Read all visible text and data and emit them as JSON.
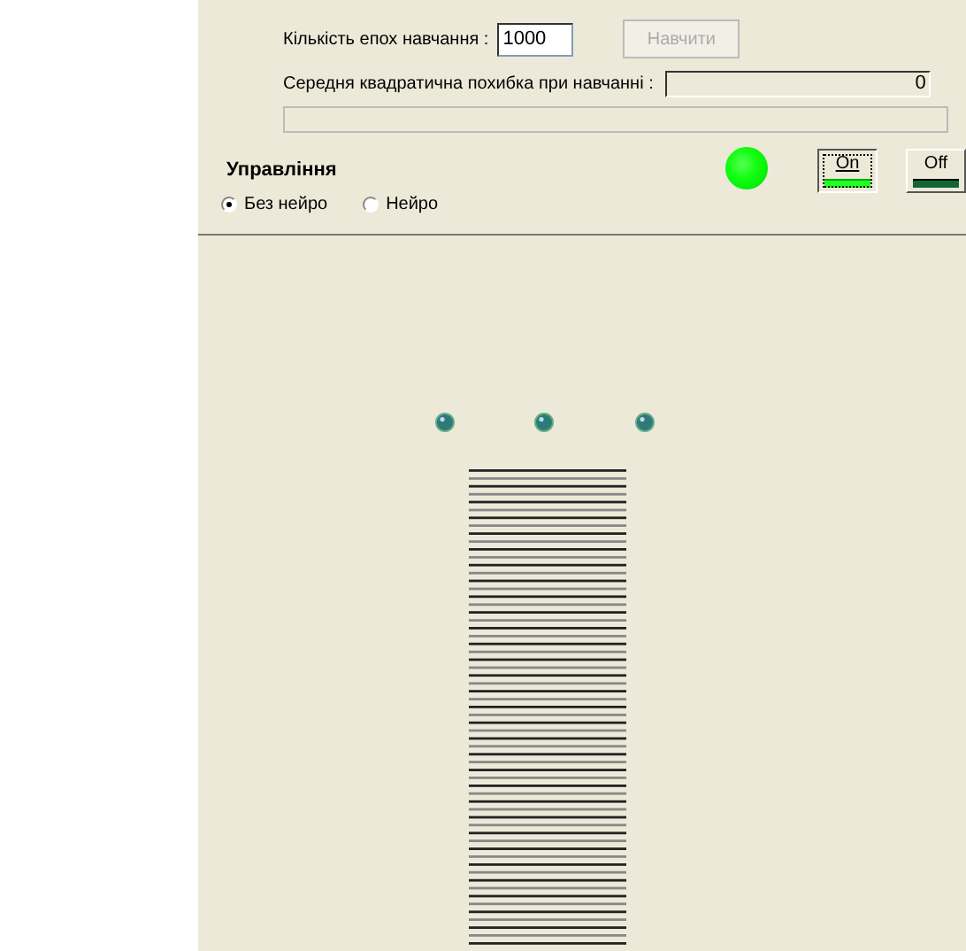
{
  "training": {
    "epochs_label": "Кількість епох навчання :",
    "epochs_value": "1000",
    "train_button": {
      "label": "Навчити",
      "disabled": true
    },
    "error_label": "Середня квадратична похибка при навчанні :",
    "error_value": "0",
    "progress": {
      "level": 0
    }
  },
  "control": {
    "title": "Управління",
    "modes": [
      {
        "label": "Без нейро",
        "selected": true
      },
      {
        "label": "Нейро",
        "selected": false
      }
    ],
    "indicator": {
      "on": true
    },
    "switches": [
      {
        "label": "On",
        "lit": true,
        "focused": true
      },
      {
        "label": "Off",
        "lit": false,
        "focused": false
      }
    ]
  }
}
